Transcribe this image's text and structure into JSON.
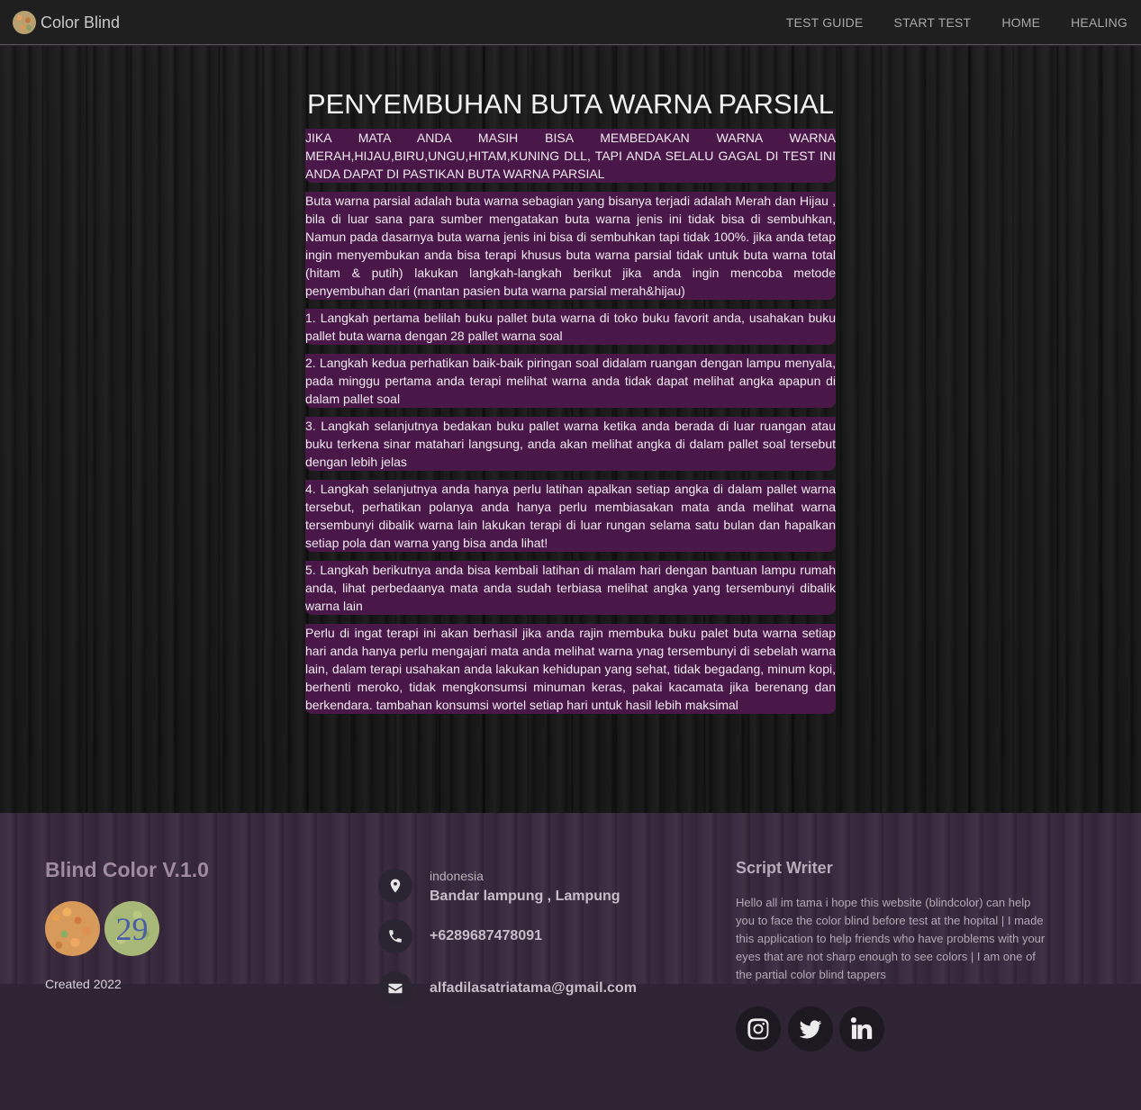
{
  "navbar": {
    "brand": "Color Blind",
    "links": [
      "TEST GUIDE",
      "START TEST",
      "HOME",
      "HEALING"
    ]
  },
  "main": {
    "title": "PENYEMBUHAN BUTA WARNA PARSIAL",
    "paragraphs": [
      "JIKA MATA ANDA MASIH BISA MEMBEDAKAN WARNA WARNA MERAH,HIJAU,BIRU,UNGU,HITAM,KUNING DLL, TAPI ANDA SELALU GAGAL DI TEST INI ANDA DAPAT DI PASTIKAN BUTA WARNA PARSIAL",
      "Buta warna parsial adalah buta warna sebagian yang bisanya terjadi adalah Merah dan Hijau , bila di luar sana para sumber mengatakan buta warna jenis ini tidak bisa di sembuhkan, Namun pada dasarnya buta warna jenis ini bisa di sembuhkan tapi tidak 100%. jika anda tetap ingin menyembukan anda bisa terapi khusus buta warna parsial tidak untuk buta warna total (hitam & putih) lakukan langkah-langkah berikut jika anda ingin mencoba metode penyembuhan dari (mantan pasien buta warna parsial merah&hijau)",
      "1. Langkah pertama belilah buku pallet buta warna di toko buku favorit anda, usahakan buku pallet buta warna dengan 28 pallet warna soal",
      "2. Langkah kedua perhatikan baik-baik piringan soal didalam ruangan dengan lampu menyala, pada minggu pertama anda terapi melihat warna anda tidak dapat melihat angka apapun di dalam pallet soal",
      "3. Langkah selanjutnya bedakan buku pallet warna ketika anda berada di luar ruangan atau buku terkena sinar matahari langsung, anda akan melihat angka di dalam pallet soal tersebut dengan lebih jelas",
      "4. Langkah selanjutnya anda hanya perlu latihan apalkan setiap angka di dalam pallet warna tersebut, perhatikan polanya anda hanya perlu membiasakan mata anda melihat warna tersembunyi dibalik warna lain lakukan terapi di luar rungan selama satu bulan dan hapalkan setiap pola dan warna yang bisa anda lihat!",
      "5. Langkah berikutnya anda bisa kembali latihan di malam hari dengan bantuan lampu rumah anda, lihat perbedaanya mata anda sudah terbiasa melihat angka yang tersembunyi dibalik warna lain",
      "Perlu di ingat terapi ini akan berhasil jika anda rajin membuka buku palet buta warna setiap hari anda hanya perlu mengajari mata anda melihat warna ynag tersembunyi di sebelah warna lain, dalam terapi usahakan anda lakukan kehidupan yang sehat, tidak begadang, minum kopi, berhenti meroko, tidak mengkonsumsi minuman keras, pakai kacamata jika berenang dan berkendara. tambahan konsumsi wortel setiap hari untuk hasil lebih maksimal"
    ]
  },
  "footer": {
    "title": "Blind Color V.1.0",
    "plate_number": "29",
    "created": "Created 2022",
    "location_country": "indonesia",
    "location_city": "Bandar lampung , Lampung",
    "phone": "+6289687478091",
    "email": "alfadilasatriatama@gmail.com",
    "script_writer_title": "Script Writer",
    "script_writer_text": "Hello all im tama i hope this website (blindcolor) can help you to face the color blind before test at the hopital | I made this application to help friends who have problems with your eyes that are not sharp enough to see colors | I am one of the partial color blind tappers",
    "icons": [
      "map-pin-icon",
      "phone-icon",
      "envelope-icon"
    ],
    "social_icons": [
      "instagram-icon",
      "twitter-icon",
      "linkedin-icon"
    ]
  },
  "colors": {
    "paragraph_bg": "#4a1848",
    "footer_bg": "#3b2b40",
    "navbar_bg": "#1f1f1f"
  }
}
